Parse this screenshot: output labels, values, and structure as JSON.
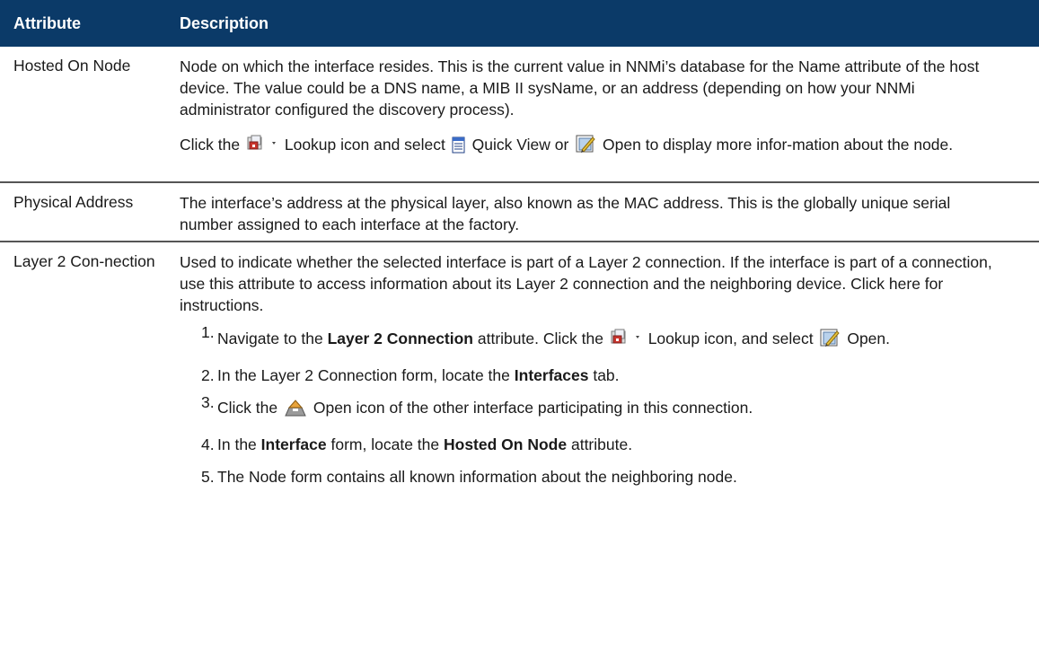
{
  "header": {
    "col_attribute": "Attribute",
    "col_description": "Description"
  },
  "rows": [
    {
      "attribute": "Hosted On Node",
      "description": "Node on which the interface resides. This is the current value in NNMi’s database for the Name attribute of the host device. The value could be a DNS name, a MIB II sysName, or an address (depending on how your NNMi administrator configured the discovery process).",
      "line2": {
        "t1": "Click the",
        "t2": "Lookup icon and select",
        "t3": "Quick View or",
        "t4": "Open to display more infor-mation about the node."
      }
    },
    {
      "attribute": "Physical Address",
      "description": "The interface’s address at the physical layer, also known as the MAC address. This is the globally unique serial number assigned to each interface at the factory."
    },
    {
      "attribute": "Layer 2 Con-nection",
      "description": "Used to indicate whether the selected interface is part of a Layer 2 connection. If the interface is part of a connection, use this attribute to access information about its Layer 2 connection and the neighboring device. Click here for instructions.",
      "steps": [
        {
          "n": "1.",
          "a": "Navigate to the",
          "b": "Layer 2 Connection",
          "c": "attribute. Click the",
          "d": "Lookup icon, and select",
          "e": "Open."
        },
        {
          "n": "2.",
          "a": "In the Layer 2 Connection form, locate the",
          "b": "Interfaces",
          "c": "tab."
        },
        {
          "n": "3.",
          "a": "Click the",
          "b": "Open icon of the other interface participating in this connection."
        },
        {
          "n": "4.",
          "a": "In the",
          "b": "Interface",
          "c": "form, locate the",
          "d": "Hosted On Node",
          "e": "attribute."
        },
        {
          "n": "5.",
          "a": "The Node form contains all known information about the neighboring node."
        }
      ]
    }
  ],
  "icons": {
    "lookup": "lookup-icon",
    "quick_view": "quick-view-icon",
    "open": "open-icon",
    "open_alt": "open-alt-icon"
  }
}
